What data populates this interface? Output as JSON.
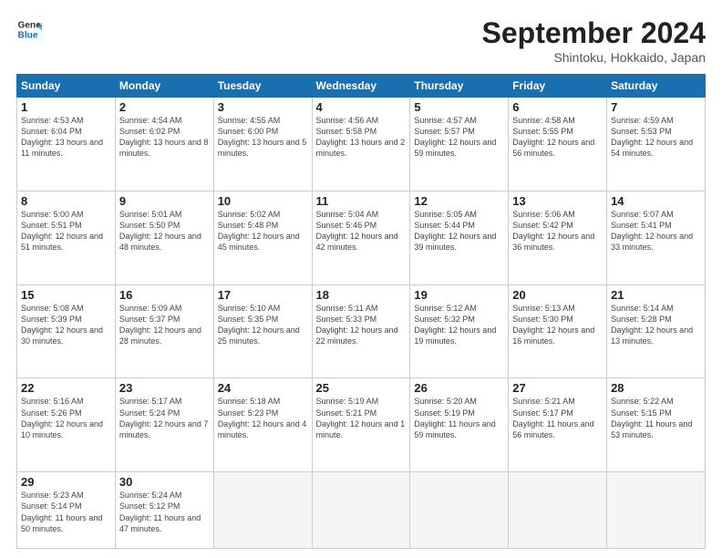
{
  "logo": {
    "line1": "General",
    "line2": "Blue"
  },
  "title": "September 2024",
  "subtitle": "Shintoku, Hokkaido, Japan",
  "days_header": [
    "Sunday",
    "Monday",
    "Tuesday",
    "Wednesday",
    "Thursday",
    "Friday",
    "Saturday"
  ],
  "weeks": [
    [
      {
        "day": "1",
        "sunrise": "Sunrise: 4:53 AM",
        "sunset": "Sunset: 6:04 PM",
        "daylight": "Daylight: 13 hours and 11 minutes."
      },
      {
        "day": "2",
        "sunrise": "Sunrise: 4:54 AM",
        "sunset": "Sunset: 6:02 PM",
        "daylight": "Daylight: 13 hours and 8 minutes."
      },
      {
        "day": "3",
        "sunrise": "Sunrise: 4:55 AM",
        "sunset": "Sunset: 6:00 PM",
        "daylight": "Daylight: 13 hours and 5 minutes."
      },
      {
        "day": "4",
        "sunrise": "Sunrise: 4:56 AM",
        "sunset": "Sunset: 5:58 PM",
        "daylight": "Daylight: 13 hours and 2 minutes."
      },
      {
        "day": "5",
        "sunrise": "Sunrise: 4:57 AM",
        "sunset": "Sunset: 5:57 PM",
        "daylight": "Daylight: 12 hours and 59 minutes."
      },
      {
        "day": "6",
        "sunrise": "Sunrise: 4:58 AM",
        "sunset": "Sunset: 5:55 PM",
        "daylight": "Daylight: 12 hours and 56 minutes."
      },
      {
        "day": "7",
        "sunrise": "Sunrise: 4:59 AM",
        "sunset": "Sunset: 5:53 PM",
        "daylight": "Daylight: 12 hours and 54 minutes."
      }
    ],
    [
      {
        "day": "8",
        "sunrise": "Sunrise: 5:00 AM",
        "sunset": "Sunset: 5:51 PM",
        "daylight": "Daylight: 12 hours and 51 minutes."
      },
      {
        "day": "9",
        "sunrise": "Sunrise: 5:01 AM",
        "sunset": "Sunset: 5:50 PM",
        "daylight": "Daylight: 12 hours and 48 minutes."
      },
      {
        "day": "10",
        "sunrise": "Sunrise: 5:02 AM",
        "sunset": "Sunset: 5:48 PM",
        "daylight": "Daylight: 12 hours and 45 minutes."
      },
      {
        "day": "11",
        "sunrise": "Sunrise: 5:04 AM",
        "sunset": "Sunset: 5:46 PM",
        "daylight": "Daylight: 12 hours and 42 minutes."
      },
      {
        "day": "12",
        "sunrise": "Sunrise: 5:05 AM",
        "sunset": "Sunset: 5:44 PM",
        "daylight": "Daylight: 12 hours and 39 minutes."
      },
      {
        "day": "13",
        "sunrise": "Sunrise: 5:06 AM",
        "sunset": "Sunset: 5:42 PM",
        "daylight": "Daylight: 12 hours and 36 minutes."
      },
      {
        "day": "14",
        "sunrise": "Sunrise: 5:07 AM",
        "sunset": "Sunset: 5:41 PM",
        "daylight": "Daylight: 12 hours and 33 minutes."
      }
    ],
    [
      {
        "day": "15",
        "sunrise": "Sunrise: 5:08 AM",
        "sunset": "Sunset: 5:39 PM",
        "daylight": "Daylight: 12 hours and 30 minutes."
      },
      {
        "day": "16",
        "sunrise": "Sunrise: 5:09 AM",
        "sunset": "Sunset: 5:37 PM",
        "daylight": "Daylight: 12 hours and 28 minutes."
      },
      {
        "day": "17",
        "sunrise": "Sunrise: 5:10 AM",
        "sunset": "Sunset: 5:35 PM",
        "daylight": "Daylight: 12 hours and 25 minutes."
      },
      {
        "day": "18",
        "sunrise": "Sunrise: 5:11 AM",
        "sunset": "Sunset: 5:33 PM",
        "daylight": "Daylight: 12 hours and 22 minutes."
      },
      {
        "day": "19",
        "sunrise": "Sunrise: 5:12 AM",
        "sunset": "Sunset: 5:32 PM",
        "daylight": "Daylight: 12 hours and 19 minutes."
      },
      {
        "day": "20",
        "sunrise": "Sunrise: 5:13 AM",
        "sunset": "Sunset: 5:30 PM",
        "daylight": "Daylight: 12 hours and 16 minutes."
      },
      {
        "day": "21",
        "sunrise": "Sunrise: 5:14 AM",
        "sunset": "Sunset: 5:28 PM",
        "daylight": "Daylight: 12 hours and 13 minutes."
      }
    ],
    [
      {
        "day": "22",
        "sunrise": "Sunrise: 5:16 AM",
        "sunset": "Sunset: 5:26 PM",
        "daylight": "Daylight: 12 hours and 10 minutes."
      },
      {
        "day": "23",
        "sunrise": "Sunrise: 5:17 AM",
        "sunset": "Sunset: 5:24 PM",
        "daylight": "Daylight: 12 hours and 7 minutes."
      },
      {
        "day": "24",
        "sunrise": "Sunrise: 5:18 AM",
        "sunset": "Sunset: 5:23 PM",
        "daylight": "Daylight: 12 hours and 4 minutes."
      },
      {
        "day": "25",
        "sunrise": "Sunrise: 5:19 AM",
        "sunset": "Sunset: 5:21 PM",
        "daylight": "Daylight: 12 hours and 1 minute."
      },
      {
        "day": "26",
        "sunrise": "Sunrise: 5:20 AM",
        "sunset": "Sunset: 5:19 PM",
        "daylight": "Daylight: 11 hours and 59 minutes."
      },
      {
        "day": "27",
        "sunrise": "Sunrise: 5:21 AM",
        "sunset": "Sunset: 5:17 PM",
        "daylight": "Daylight: 11 hours and 56 minutes."
      },
      {
        "day": "28",
        "sunrise": "Sunrise: 5:22 AM",
        "sunset": "Sunset: 5:15 PM",
        "daylight": "Daylight: 11 hours and 53 minutes."
      }
    ],
    [
      {
        "day": "29",
        "sunrise": "Sunrise: 5:23 AM",
        "sunset": "Sunset: 5:14 PM",
        "daylight": "Daylight: 11 hours and 50 minutes."
      },
      {
        "day": "30",
        "sunrise": "Sunrise: 5:24 AM",
        "sunset": "Sunset: 5:12 PM",
        "daylight": "Daylight: 11 hours and 47 minutes."
      },
      null,
      null,
      null,
      null,
      null
    ]
  ]
}
